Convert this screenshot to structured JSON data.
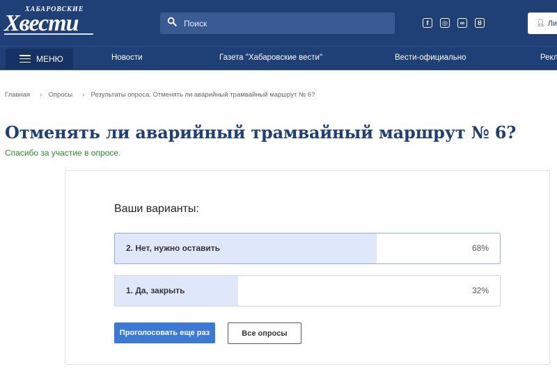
{
  "header": {
    "logo_small": "ХАБАРОВСКИЕ",
    "logo_big": "Хвести",
    "search": {
      "placeholder": "Поиск",
      "icon": "search-icon"
    },
    "socials": [
      {
        "name": "facebook-icon",
        "glyph": "f"
      },
      {
        "name": "instagram-icon",
        "glyph": "◎"
      },
      {
        "name": "vk-icon",
        "glyph": "∞"
      },
      {
        "name": "odnoklassniki-icon",
        "glyph": "ȣ"
      }
    ],
    "account_label": "Лич",
    "colors": {
      "header_bg": "#1f3f77",
      "menu_bg": "#163163",
      "accent": "#3a7ad6",
      "success": "#2a8a2a"
    }
  },
  "nav": {
    "menu_label": "МЕНЮ",
    "links": [
      "Новости",
      "Газета \"Хабаровские вести\"",
      "Вести-официально",
      "Рекл"
    ]
  },
  "breadcrumb": {
    "items": [
      "Главная",
      "Опросы",
      "Результаты опроса: Отменять ли аварийный трамвайный маршрут № 6?"
    ]
  },
  "page": {
    "title": "Отменять ли аварийный трамвайный маршрут № 6?",
    "thanks": "Спасибо за участие в опросе."
  },
  "poll": {
    "heading": "Ваши варианты:",
    "results": [
      {
        "label": "2. Нет, нужно оставить",
        "percent_text": "68%",
        "fraction": 0.68
      },
      {
        "label": "1. Да, закрыть",
        "percent_text": "32%",
        "fraction": 0.32
      }
    ],
    "vote_again_label": "Проголосовать еще раз",
    "all_polls_label": "Все опросы"
  }
}
